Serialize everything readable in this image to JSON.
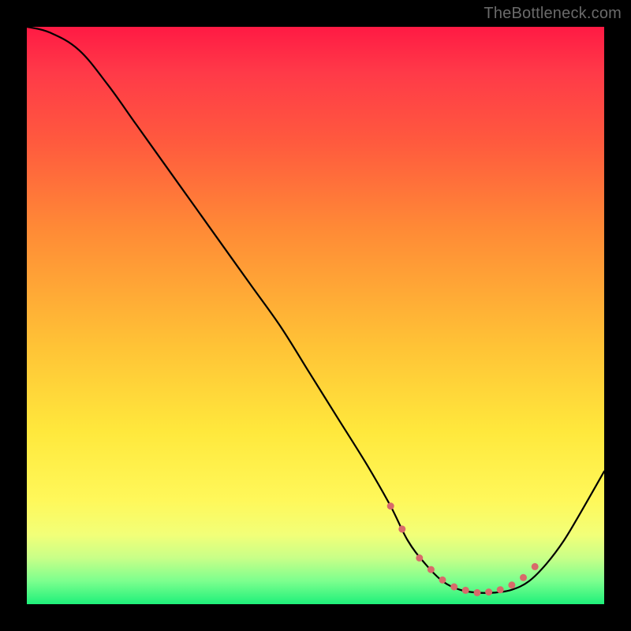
{
  "watermark": "TheBottleneck.com",
  "chart_data": {
    "type": "line",
    "title": "",
    "xlabel": "",
    "ylabel": "",
    "xlim": [
      0,
      100
    ],
    "ylim": [
      0,
      100
    ],
    "series": [
      {
        "name": "bottleneck-curve",
        "x": [
          0,
          4,
          9,
          14,
          19,
          24,
          29,
          34,
          39,
          44,
          49,
          54,
          59,
          63,
          66,
          69,
          72,
          75,
          78,
          81,
          84,
          87,
          90,
          93,
          96,
          100
        ],
        "values": [
          100,
          99,
          96,
          90,
          83,
          76,
          69,
          62,
          55,
          48,
          40,
          32,
          24,
          17,
          11,
          7,
          4,
          2.5,
          2,
          2,
          2.5,
          4,
          7,
          11,
          16,
          23
        ]
      }
    ],
    "markers": {
      "name": "optimal-range-dots",
      "color": "#d86a6a",
      "x": [
        63,
        65,
        68,
        70,
        72,
        74,
        76,
        78,
        80,
        82,
        84,
        86,
        88
      ],
      "values": [
        17,
        13,
        8,
        6,
        4.2,
        3,
        2.4,
        2,
        2.1,
        2.5,
        3.3,
        4.6,
        6.5
      ]
    }
  }
}
